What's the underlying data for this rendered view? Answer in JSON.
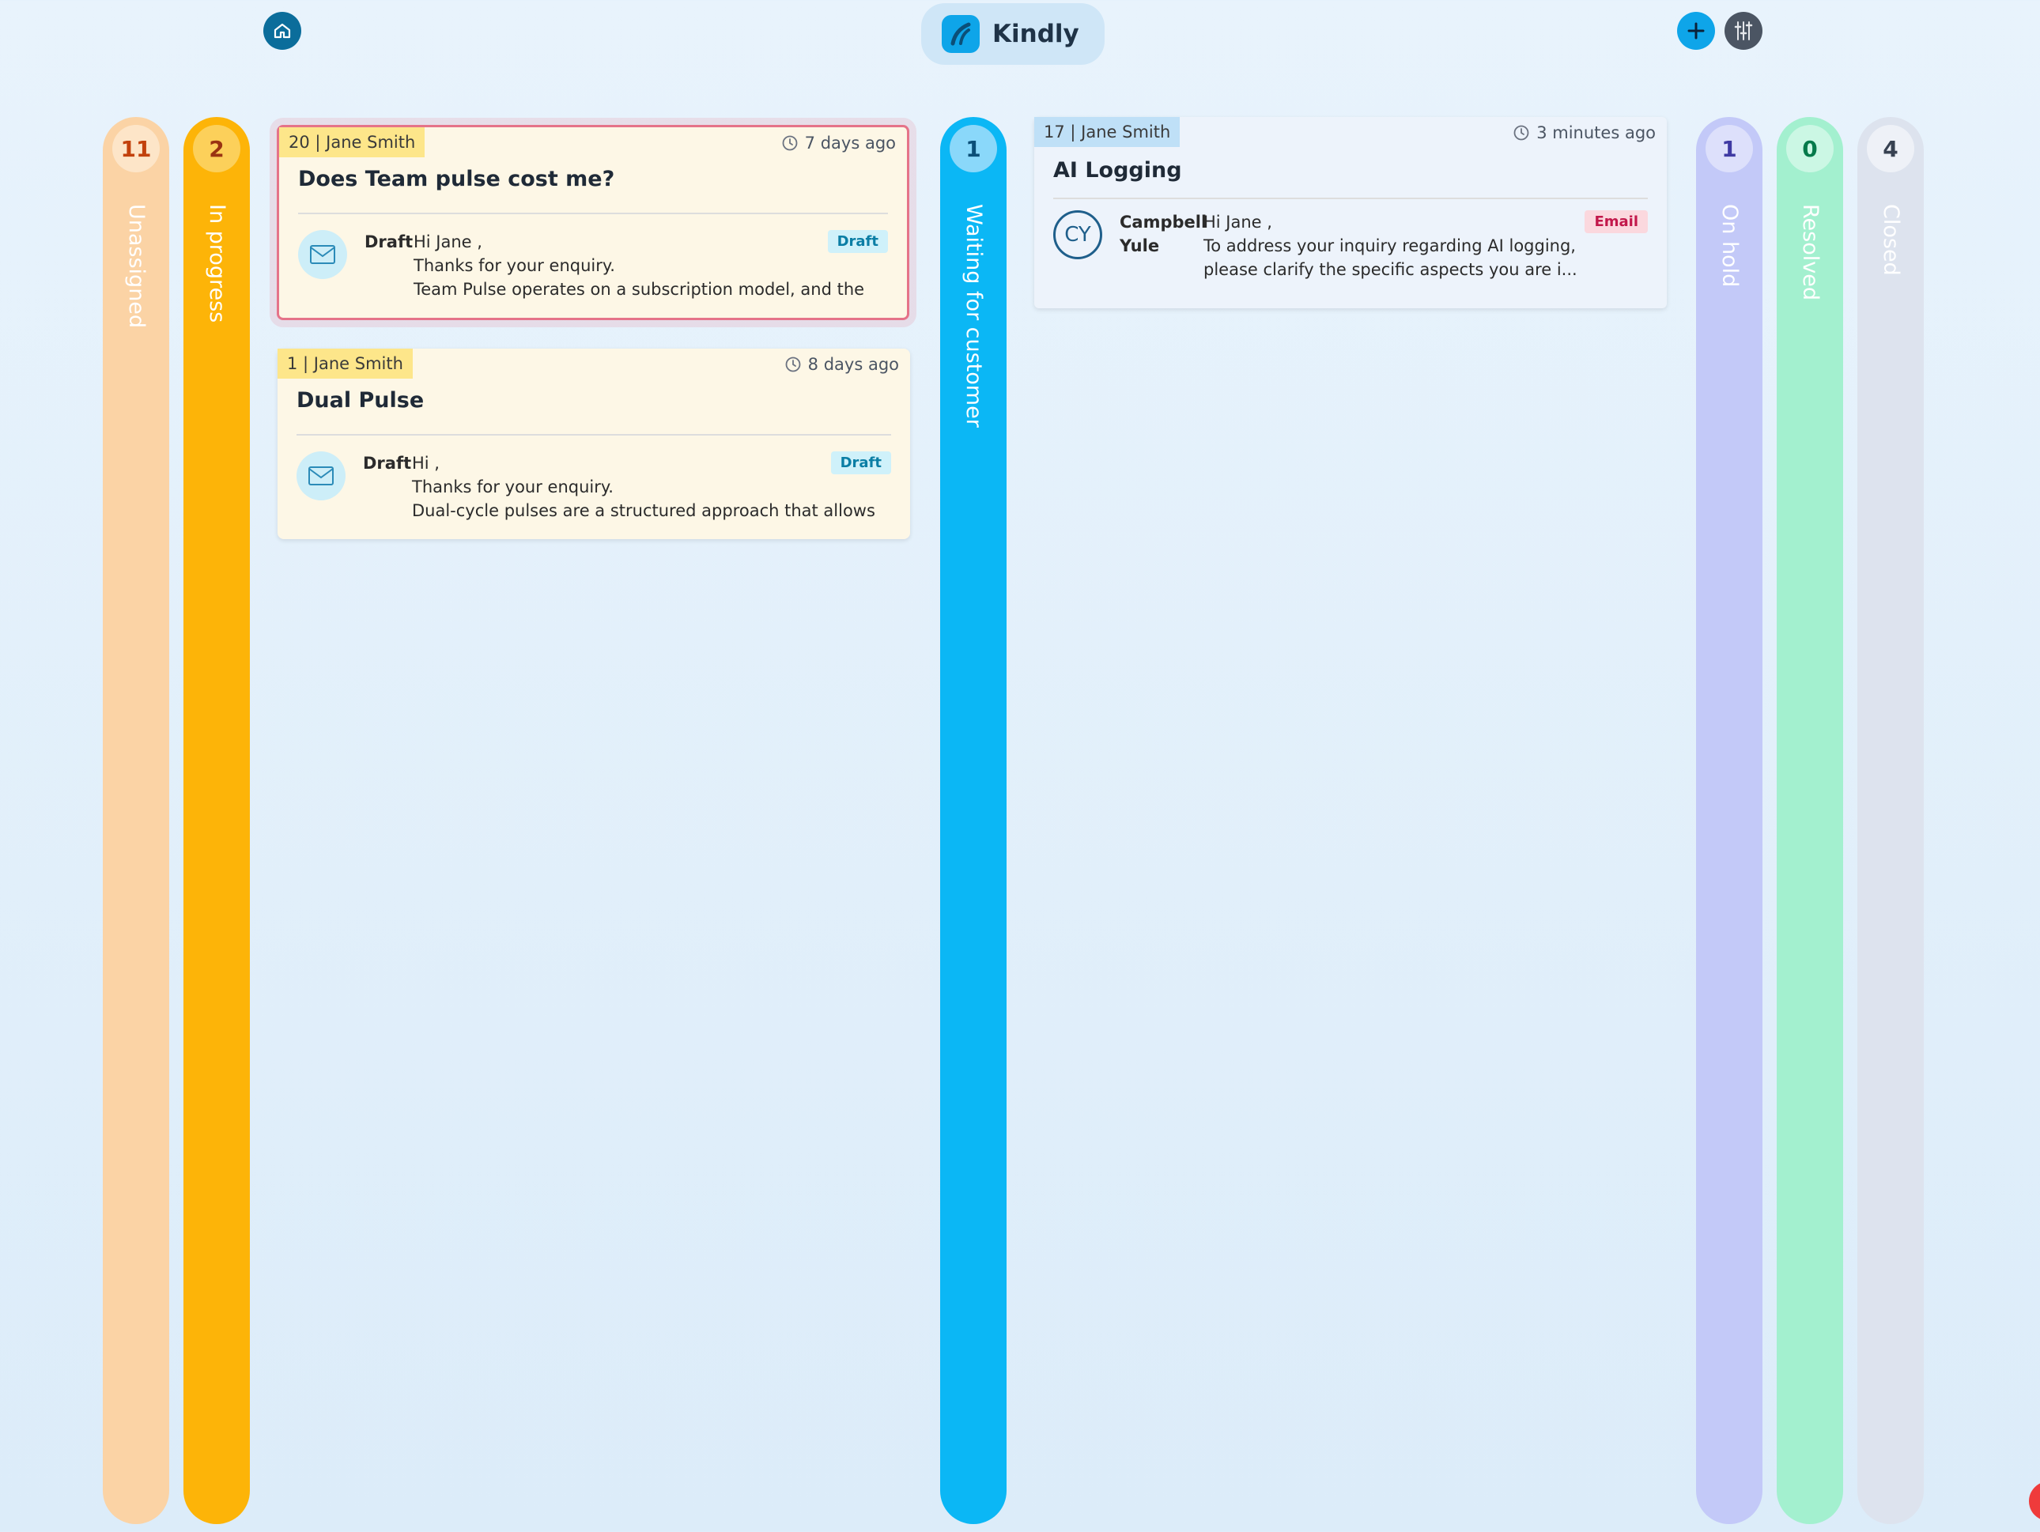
{
  "brand": {
    "name": "Kindly"
  },
  "icons": {
    "home": "home-icon",
    "logo": "kindly-logo-icon",
    "add": "plus-icon",
    "filter": "sliders-icon",
    "clock": "clock-icon",
    "mail": "mail-icon"
  },
  "lanes": [
    {
      "key": "unassigned",
      "count": "11",
      "label": "Unassigned",
      "color": "#fbd3a5",
      "count_bg": "#fde5c8",
      "count_color": "#c2410c"
    },
    {
      "key": "in_progress",
      "count": "2",
      "label": "In progress",
      "color": "#fdb408",
      "count_bg": "#fcd05a",
      "count_color": "#9a3412"
    },
    {
      "key": "waiting",
      "count": "1",
      "label": "Waiting for customer",
      "color": "#0bb7f5",
      "count_bg": "#8ad8fa",
      "count_color": "#0b4f78"
    },
    {
      "key": "on_hold",
      "count": "1",
      "label": "On hold",
      "color": "#c3c9f8",
      "count_bg": "#dde0fb",
      "count_color": "#3f3aa3"
    },
    {
      "key": "resolved",
      "count": "0",
      "label": "Resolved",
      "color": "#a3f0cf",
      "count_bg": "#cbf7e4",
      "count_color": "#067a4b"
    },
    {
      "key": "closed",
      "count": "4",
      "label": "Closed",
      "color": "#dde3ee",
      "count_bg": "#eef1f7",
      "count_color": "#374151"
    }
  ],
  "cards": {
    "c1": {
      "tag": "20 | Jane Smith",
      "time": "7 days ago",
      "title": "Does Team pulse cost me?",
      "author": "Draft",
      "lines": [
        "Hi Jane ,",
        "Thanks for your enquiry.",
        "Team Pulse operates on a subscription model, and the"
      ],
      "badge": "Draft"
    },
    "c2": {
      "tag": "1 | Jane Smith",
      "time": "8 days ago",
      "title": "Dual Pulse",
      "author": "Draft",
      "lines": [
        "Hi ,",
        "Thanks for your enquiry.",
        "Dual-cycle pulses are a structured approach that allows"
      ],
      "badge": "Draft"
    },
    "c3": {
      "tag": "17 | Jane Smith",
      "time": "3 minutes ago",
      "title": "AI Logging",
      "avatar": "CY",
      "sender": "Campbell Yule",
      "lines": [
        "Hi Jane ,",
        "To address your inquiry regarding AI logging,",
        "please clarify the specific aspects you are i..."
      ],
      "badge": "Email"
    }
  },
  "colors": {
    "tag_yellow": "#fde68a",
    "tag_blue": "#bfe0f7",
    "accent": "#0ea5e9"
  }
}
